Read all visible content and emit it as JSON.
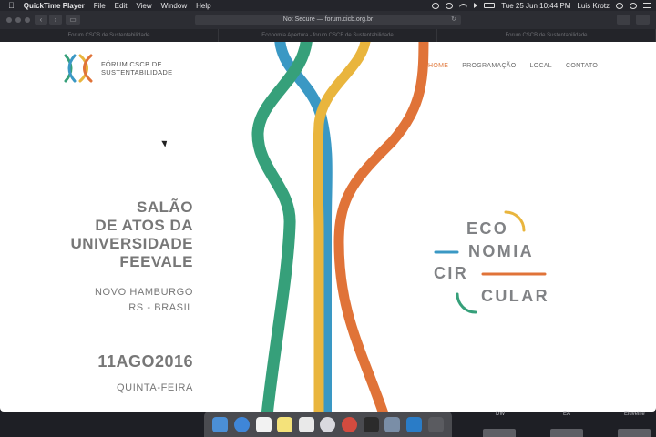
{
  "menubar": {
    "app_name": "QuickTime Player",
    "menus": [
      "File",
      "Edit",
      "View",
      "Window",
      "Help"
    ],
    "date_time": "Tue 25 Jun  10:44 PM",
    "user": "Luis Krotz"
  },
  "browser": {
    "address": "Not Secure — forum.cicb.org.br",
    "tabs": [
      "Forum CSCB de Sustentabilidade",
      "Economia Apertura - forum CSCB de Sustentabilidade",
      "Forum CSCB de Sustentabilidade"
    ]
  },
  "site": {
    "brand_line1": "FÓRUM CSCB DE",
    "brand_line2": "SUSTENTABILIDADE",
    "nav": [
      "HOME",
      "PROGRAMAÇÃO",
      "LOCAL",
      "CONTATO"
    ],
    "venue": [
      "SALÃO",
      "DE ATOS DA",
      "UNIVERSIDADE",
      "FEEVALE"
    ],
    "city": [
      "NOVO HAMBURGO",
      "RS - BRASIL"
    ],
    "date": "11AGO2016",
    "weekday": "QUINTA-FEIRA",
    "eco_words": [
      "ECO",
      "NOMIA",
      "CIR",
      "CULAR"
    ]
  },
  "colors": {
    "green": "#36a07a",
    "blue": "#3a98c4",
    "yellow": "#e9b53d",
    "orange": "#e07338",
    "accent_active": "#e17a3d"
  },
  "dock": {
    "icons": [
      "finder-icon",
      "safari-icon",
      "calendar-icon",
      "notes-icon",
      "photos-icon",
      "music-icon",
      "chrome-icon",
      "terminal-icon",
      "preview-icon",
      "vscode-icon",
      "folder-icon"
    ]
  },
  "right_panel": {
    "labels": [
      "DW",
      "EA",
      "Eluvellte"
    ]
  }
}
